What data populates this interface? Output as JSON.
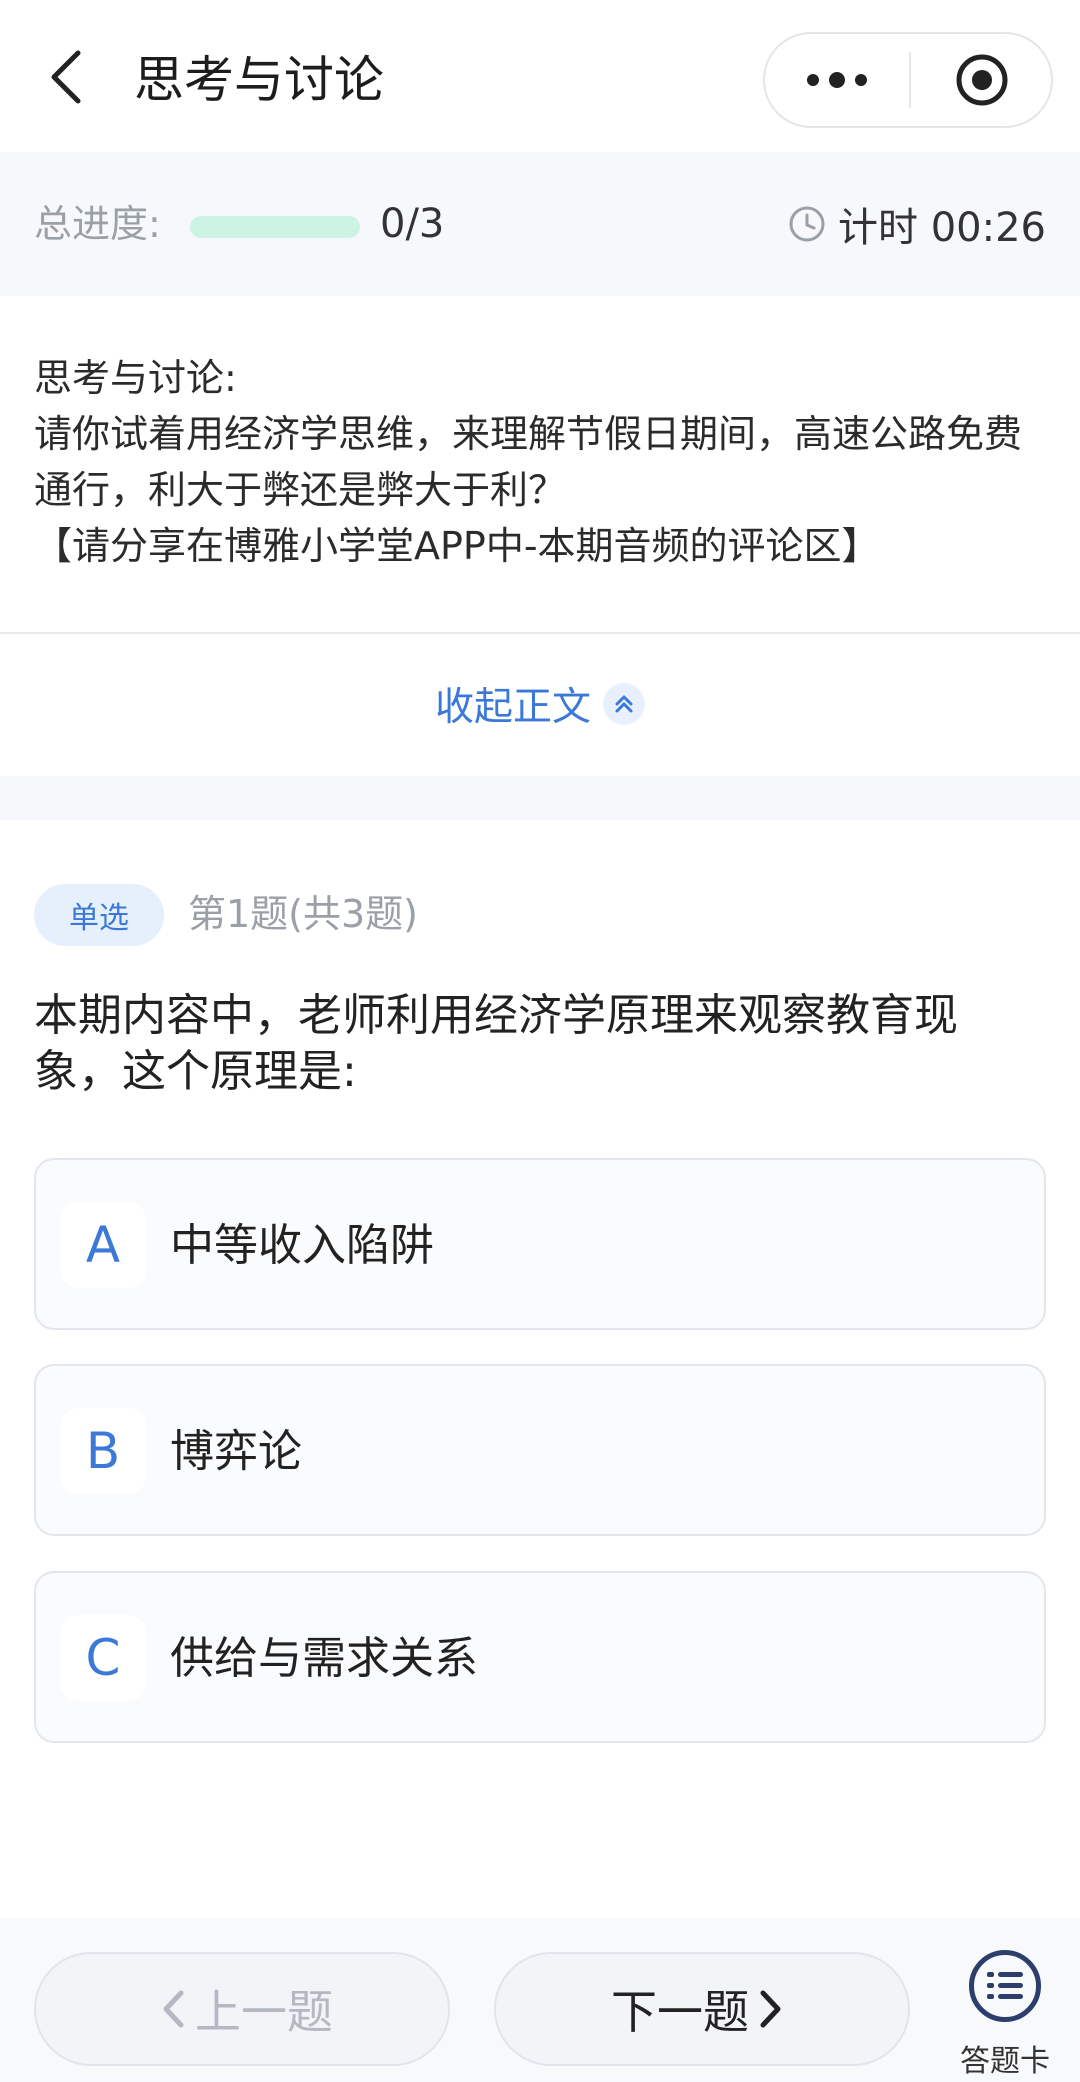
{
  "navbar": {
    "title": "思考与讨论"
  },
  "progress": {
    "label": "总进度:",
    "count": "0/3",
    "fraction": 0,
    "timer_label": "计时 00:26"
  },
  "passage": {
    "lines": [
      "思考与讨论:",
      "请你试着用经济学思维，来理解节假日期间，高速公路免费通行，利大于弊还是弊大于利？",
      "【请分享在博雅小学堂APP中-本期音频的评论区】"
    ],
    "collapse_label": "收起正文"
  },
  "question": {
    "tag": "单选",
    "index": "第1题(共3题)",
    "text": "本期内容中，老师利用经济学原理来观察教育现象，这个原理是:",
    "options": [
      {
        "letter": "A",
        "text": "中等收入陷阱"
      },
      {
        "letter": "B",
        "text": "博弈论"
      },
      {
        "letter": "C",
        "text": "供给与需求关系"
      }
    ]
  },
  "bottom": {
    "prev_label": "上一题",
    "next_label": "下一题",
    "card_label": "答题卡"
  },
  "colors": {
    "accent": "#3b78d8",
    "progress": "#35c48f",
    "progress_track": "#ccf3e4",
    "section_bg": "#f6f8fc"
  },
  "icons": {
    "back": "chevron-left-icon",
    "more": "more-dots-icon",
    "close": "target-close-icon",
    "timer": "clock-icon",
    "collapse": "double-chevron-up-icon",
    "prev": "chevron-left-icon",
    "next": "chevron-right-icon",
    "answer_card": "list-icon"
  }
}
